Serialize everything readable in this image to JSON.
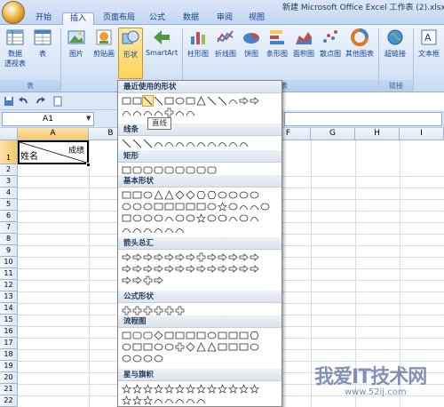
{
  "window": {
    "title": "新建 Microsoft Office Excel 工作表 (2).xlsx"
  },
  "tabs": [
    "开始",
    "插入",
    "页面布局",
    "公式",
    "数据",
    "审阅",
    "视图"
  ],
  "ribbon": {
    "buttons": [
      "数据\n透视表",
      "表",
      "图片",
      "剪贴画",
      "形状",
      "SmartArt",
      "柱形图",
      "折线图",
      "饼图",
      "条形图",
      "面积图",
      "散点图",
      "其他图表",
      "超链接",
      "文本框"
    ],
    "groups": [
      "表",
      "图表",
      "链接"
    ],
    "extra_labels": [
      "数据",
      "透视表"
    ]
  },
  "namebox": {
    "value": "A1"
  },
  "sheet": {
    "columns": [
      "A",
      "B",
      "C",
      "D",
      "E",
      "F",
      "G",
      "H",
      "I"
    ],
    "rows": [
      "1",
      "2",
      "3",
      "4",
      "5",
      "6",
      "7",
      "8",
      "9",
      "10",
      "11",
      "12",
      "13",
      "14",
      "15",
      "16",
      "17",
      "18",
      "19",
      "20",
      "21",
      "22"
    ],
    "a1_top": "成绩",
    "a1_bottom": "姓名"
  },
  "shapes": {
    "sections": [
      "最近使用的形状",
      "线条",
      "矩形",
      "基本形状",
      "箭头总汇",
      "公式形状",
      "流程图",
      "星与旗帜"
    ],
    "tooltip": "直线"
  },
  "watermark": {
    "title": "我爱IT技术网",
    "url": "www.52ij.com"
  }
}
